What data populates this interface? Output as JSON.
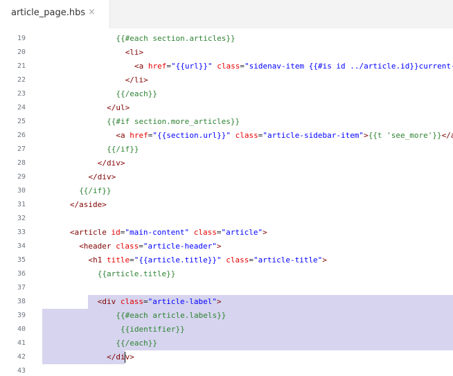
{
  "tab": {
    "filename": "article_page.hbs",
    "close_glyph": "×",
    "close_icon": "close-icon"
  },
  "colors": {
    "tag": "#800000",
    "attribute": "#e50000",
    "string": "#0000ff",
    "handlebars": "#2d8232",
    "line_number": "#6e7681",
    "selection": "#d6d4ee"
  },
  "editor": {
    "lines": [
      {
        "num": "19",
        "indent": 8,
        "tokens": [
          {
            "t": "hb",
            "v": "{{#each section.articles}}"
          }
        ]
      },
      {
        "num": "20",
        "indent": 9,
        "tokens": [
          {
            "t": "tag",
            "v": "<li>"
          }
        ]
      },
      {
        "num": "21",
        "indent": 10,
        "tokens": [
          {
            "t": "tag",
            "v": "<a "
          },
          {
            "t": "attr",
            "v": "href"
          },
          {
            "t": "txt",
            "v": "="
          },
          {
            "t": "str",
            "v": "\"{{url}}\""
          },
          {
            "t": "txt",
            "v": " "
          },
          {
            "t": "attr",
            "v": "class"
          },
          {
            "t": "txt",
            "v": "="
          },
          {
            "t": "str",
            "v": "\"sidenav-item {{#is id ../article.id}}current-ar"
          }
        ]
      },
      {
        "num": "22",
        "indent": 9,
        "tokens": [
          {
            "t": "tag",
            "v": "</li>"
          }
        ]
      },
      {
        "num": "23",
        "indent": 8,
        "tokens": [
          {
            "t": "hb",
            "v": "{{/each}}"
          }
        ]
      },
      {
        "num": "24",
        "indent": 7,
        "tokens": [
          {
            "t": "tag",
            "v": "</ul>"
          }
        ]
      },
      {
        "num": "25",
        "indent": 7,
        "tokens": [
          {
            "t": "hb",
            "v": "{{#if section.more_articles}}"
          }
        ]
      },
      {
        "num": "26",
        "indent": 8,
        "tokens": [
          {
            "t": "tag",
            "v": "<a "
          },
          {
            "t": "attr",
            "v": "href"
          },
          {
            "t": "txt",
            "v": "="
          },
          {
            "t": "str",
            "v": "\"{{section.url}}\""
          },
          {
            "t": "txt",
            "v": " "
          },
          {
            "t": "attr",
            "v": "class"
          },
          {
            "t": "txt",
            "v": "="
          },
          {
            "t": "str",
            "v": "\"article-sidebar-item\""
          },
          {
            "t": "tag",
            "v": ">"
          },
          {
            "t": "hb",
            "v": "{{t 'see_more'}}"
          },
          {
            "t": "tag",
            "v": "</a>"
          }
        ]
      },
      {
        "num": "27",
        "indent": 7,
        "tokens": [
          {
            "t": "hb",
            "v": "{{/if}}"
          }
        ]
      },
      {
        "num": "28",
        "indent": 6,
        "tokens": [
          {
            "t": "tag",
            "v": "</div>"
          }
        ]
      },
      {
        "num": "29",
        "indent": 5,
        "tokens": [
          {
            "t": "tag",
            "v": "</div>"
          }
        ]
      },
      {
        "num": "30",
        "indent": 4,
        "tokens": [
          {
            "t": "hb",
            "v": "{{/if}}"
          }
        ]
      },
      {
        "num": "31",
        "indent": 3,
        "tokens": [
          {
            "t": "tag",
            "v": "</aside>"
          }
        ]
      },
      {
        "num": "32",
        "indent": 0,
        "tokens": []
      },
      {
        "num": "33",
        "indent": 3,
        "tokens": [
          {
            "t": "tag",
            "v": "<article "
          },
          {
            "t": "attr",
            "v": "id"
          },
          {
            "t": "txt",
            "v": "="
          },
          {
            "t": "str",
            "v": "\"main-content\""
          },
          {
            "t": "txt",
            "v": " "
          },
          {
            "t": "attr",
            "v": "class"
          },
          {
            "t": "txt",
            "v": "="
          },
          {
            "t": "str",
            "v": "\"article\""
          },
          {
            "t": "tag",
            "v": ">"
          }
        ]
      },
      {
        "num": "34",
        "indent": 4,
        "tokens": [
          {
            "t": "tag",
            "v": "<header "
          },
          {
            "t": "attr",
            "v": "class"
          },
          {
            "t": "txt",
            "v": "="
          },
          {
            "t": "str",
            "v": "\"article-header\""
          },
          {
            "t": "tag",
            "v": ">"
          }
        ]
      },
      {
        "num": "35",
        "indent": 5,
        "tokens": [
          {
            "t": "tag",
            "v": "<h1 "
          },
          {
            "t": "attr",
            "v": "title"
          },
          {
            "t": "txt",
            "v": "="
          },
          {
            "t": "str",
            "v": "\"{{article.title}}\""
          },
          {
            "t": "txt",
            "v": " "
          },
          {
            "t": "attr",
            "v": "class"
          },
          {
            "t": "txt",
            "v": "="
          },
          {
            "t": "str",
            "v": "\"article-title\""
          },
          {
            "t": "tag",
            "v": ">"
          }
        ]
      },
      {
        "num": "36",
        "indent": 6,
        "tokens": [
          {
            "t": "hb",
            "v": "{{article.title}}"
          }
        ]
      },
      {
        "num": "37",
        "indent": 0,
        "tokens": []
      },
      {
        "num": "38",
        "indent": 6,
        "tokens": [
          {
            "t": "tag",
            "v": "<div "
          },
          {
            "t": "attr",
            "v": "class"
          },
          {
            "t": "txt",
            "v": "="
          },
          {
            "t": "str",
            "v": "\"article-label\""
          },
          {
            "t": "tag",
            "v": ">"
          }
        ]
      },
      {
        "num": "39",
        "indent": 8,
        "tokens": [
          {
            "t": "hb",
            "v": "{{#each article.labels}}"
          }
        ]
      },
      {
        "num": "40",
        "indent": 8,
        "tokens": [
          {
            "t": "hb",
            "v": " {{identifier}}"
          }
        ]
      },
      {
        "num": "41",
        "indent": 8,
        "tokens": [
          {
            "t": "hb",
            "v": "{{/each}}"
          }
        ]
      },
      {
        "num": "42",
        "indent": 7,
        "tokens": [
          {
            "t": "tag",
            "v": "</div>"
          }
        ]
      },
      {
        "num": "43",
        "indent": 0,
        "tokens": []
      }
    ]
  }
}
